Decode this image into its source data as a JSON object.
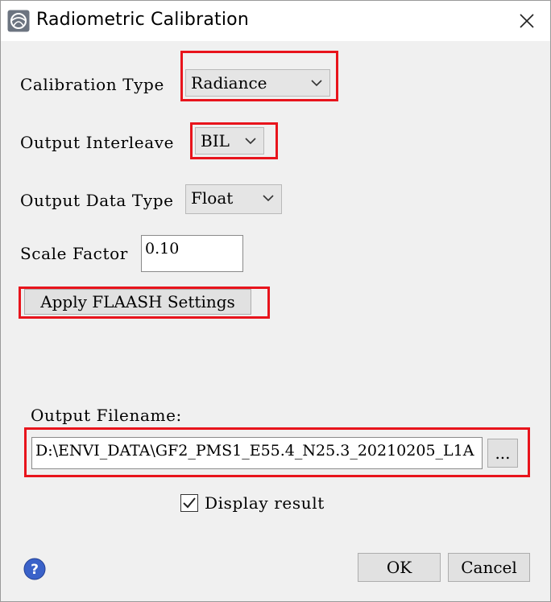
{
  "window": {
    "title": "Radiometric Calibration",
    "icons": {
      "app": "envi-app-icon",
      "close": "close-icon"
    }
  },
  "form": {
    "calibration_type": {
      "label": "Calibration Type",
      "value": "Radiance"
    },
    "output_interleave": {
      "label": "Output Interleave",
      "value": "BIL"
    },
    "output_data_type": {
      "label": "Output Data Type",
      "value": "Float"
    },
    "scale_factor": {
      "label": "Scale Factor",
      "value": "0.10"
    },
    "apply_flaash_label": "Apply FLAASH Settings",
    "output_filename": {
      "label": "Output Filename:",
      "value": "D:\\ENVI_DATA\\GF2_PMS1_E55.4_N25.3_20210205_L1A",
      "browse_label": "..."
    },
    "display_result": {
      "label": "Display result",
      "checked": true
    }
  },
  "footer": {
    "ok_label": "OK",
    "cancel_label": "Cancel",
    "help_icon": "help-icon"
  },
  "colors": {
    "highlight": "#e8141c",
    "dialog_bg": "#f0f0f0",
    "combo_bg": "#e5e5e5",
    "help_blue": "#3a62c9"
  }
}
